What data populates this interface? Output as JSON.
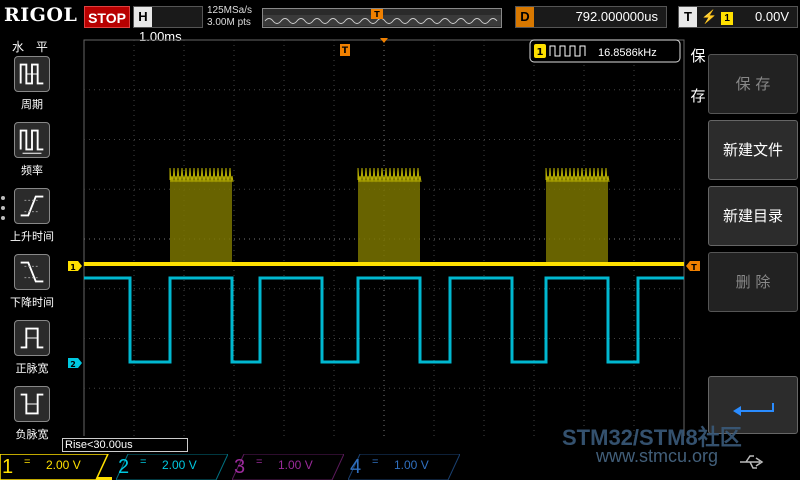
{
  "brand": "RIGOL",
  "status": {
    "run_state": "STOP"
  },
  "horizontal": {
    "key": "H",
    "timebase": "1.00ms",
    "sample_rate": "125MSa/s",
    "memory_depth": "3.00M pts"
  },
  "delay": {
    "key": "D",
    "value": "792.000000us"
  },
  "trigger": {
    "key": "T",
    "channel": "1",
    "level": "0.00V"
  },
  "left_menu": {
    "title": "水 平",
    "items": [
      {
        "label": "周期",
        "icon": "period-icon"
      },
      {
        "label": "频率",
        "icon": "frequency-icon"
      },
      {
        "label": "上升时间",
        "icon": "rise-time-icon"
      },
      {
        "label": "下降时间",
        "icon": "fall-time-icon"
      },
      {
        "label": "正脉宽",
        "icon": "positive-width-icon"
      },
      {
        "label": "负脉宽",
        "icon": "negative-width-icon"
      }
    ]
  },
  "right_menu": {
    "title_chars": [
      "保",
      "存"
    ],
    "keys": [
      {
        "label": "保 存",
        "enabled": false
      },
      {
        "label": "新建文件",
        "enabled": true
      },
      {
        "label": "新建目录",
        "enabled": true
      },
      {
        "label": "删 除",
        "enabled": false
      }
    ],
    "back_icon": "return-arrow-icon"
  },
  "measurement": {
    "channel": "1",
    "value": "16.8586kHz",
    "rise_readout": "Rise<30.00us"
  },
  "channels": [
    {
      "num": "1",
      "coupling": "=",
      "scale": "2.00 V",
      "color": "#ffe000",
      "active": true
    },
    {
      "num": "2",
      "coupling": "=",
      "scale": "2.00 V",
      "color": "#00c8e0",
      "active": false
    },
    {
      "num": "3",
      "coupling": "=",
      "scale": "1.00 V",
      "color": "#9a2a9a",
      "active": false
    },
    {
      "num": "4",
      "coupling": "=",
      "scale": "1.00 V",
      "color": "#3070c0",
      "active": false
    }
  ],
  "watermark": {
    "line1": "STM32/STM8社区",
    "line2": "www.stmcu.org"
  },
  "markers": {
    "ch1": "1",
    "ch2": "2",
    "trigger_right": "T",
    "trigger_top": "T"
  },
  "colors": {
    "ch1": "#ffe000",
    "ch2": "#00c8e0",
    "trigger": "#f08000",
    "grid": "#555555"
  }
}
